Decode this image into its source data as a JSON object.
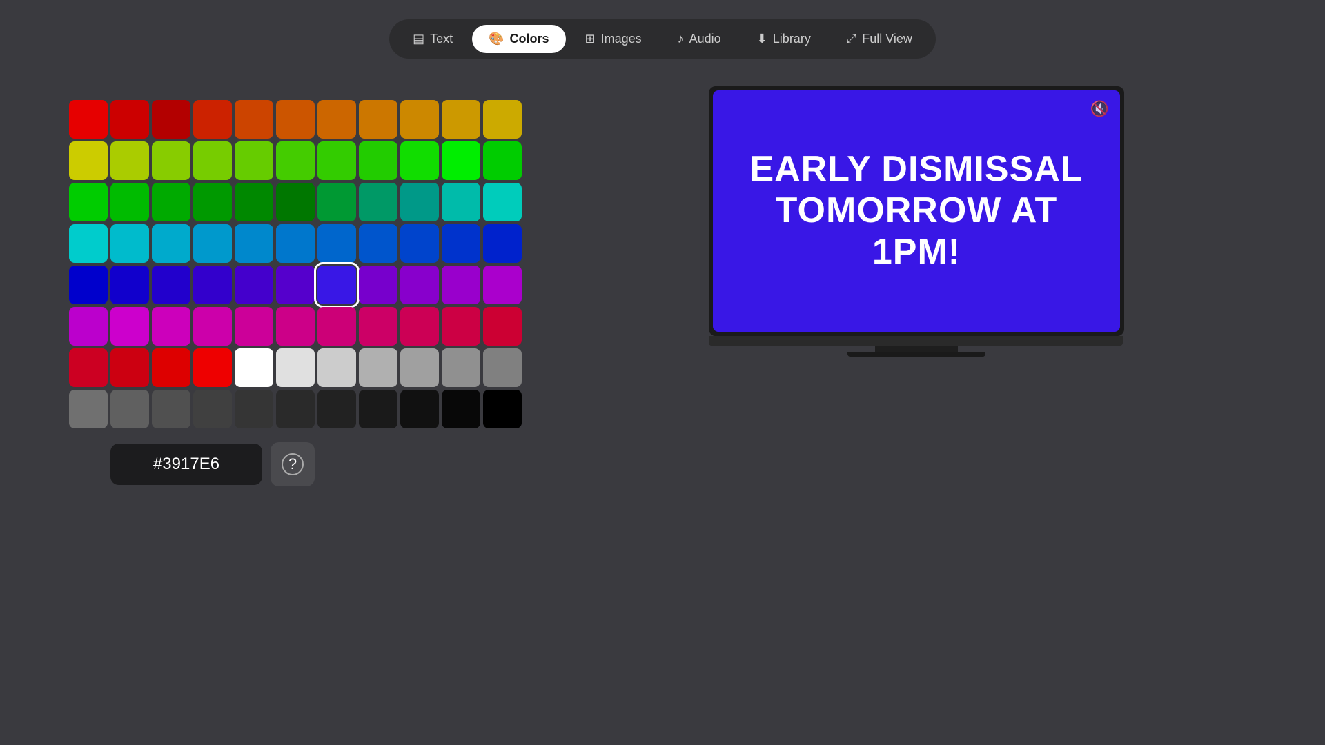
{
  "nav": {
    "items": [
      {
        "id": "text",
        "label": "Text",
        "icon": "📄",
        "active": false
      },
      {
        "id": "colors",
        "label": "Colors",
        "icon": "🎨",
        "active": true
      },
      {
        "id": "images",
        "label": "Images",
        "icon": "🖼",
        "active": false
      },
      {
        "id": "audio",
        "label": "Audio",
        "icon": "🎵",
        "active": false
      },
      {
        "id": "library",
        "label": "Library",
        "icon": "📥",
        "active": false
      },
      {
        "id": "fullview",
        "label": "Full View",
        "icon": "⤢",
        "active": false
      }
    ]
  },
  "colorGrid": {
    "rows": [
      [
        "#e60000",
        "#cc0000",
        "#b30000",
        "#cc2200",
        "#cc4400",
        "#cc5500",
        "#cc6600",
        "#cc7700",
        "#cc8800",
        "#cc9900",
        "#ccaa00"
      ],
      [
        "#cccc00",
        "#aacc00",
        "#88cc00",
        "#77cc00",
        "#66cc00",
        "#44cc00",
        "#33cc00",
        "#22cc00",
        "#11dd00",
        "#00ee00",
        "#00cc00"
      ],
      [
        "#00cc00",
        "#00bb00",
        "#00aa00",
        "#009900",
        "#008800",
        "#007700",
        "#009933",
        "#009966",
        "#009988",
        "#00bbaa",
        "#00ccbb"
      ],
      [
        "#00cccc",
        "#00bbcc",
        "#00aacc",
        "#0099cc",
        "#0088cc",
        "#0077cc",
        "#0066cc",
        "#0055cc",
        "#0044cc",
        "#0033cc",
        "#0022cc"
      ],
      [
        "#0000cc",
        "#1100cc",
        "#2200cc",
        "#3300cc",
        "#4400cc",
        "#5500cc",
        "#3917e6",
        "#7700cc",
        "#8800cc",
        "#9900cc",
        "#aa00cc"
      ],
      [
        "#bb00cc",
        "#cc00cc",
        "#cc00bb",
        "#cc00aa",
        "#cc0099",
        "#cc0088",
        "#cc0077",
        "#cc0066",
        "#cc0055",
        "#cc0044",
        "#cc0033"
      ],
      [
        "#cc0022",
        "#cc0011",
        "#dd0000",
        "#ee0000",
        "#ffffff",
        "#e0e0e0",
        "#cccccc",
        "#b0b0b0",
        "#a0a0a0",
        "#909090",
        "#808080"
      ],
      [
        "#707070",
        "#606060",
        "#505050",
        "#404040",
        "#353535",
        "#2a2a2a",
        "#222222",
        "#1a1a1a",
        "#111111",
        "#080808",
        "#000000"
      ]
    ],
    "selectedColor": "#3917e6",
    "selectedIndex": {
      "row": 4,
      "col": 6
    }
  },
  "hexInput": {
    "value": "#3917E6",
    "placeholder": "#3917E6"
  },
  "helpButton": {
    "label": "?"
  },
  "preview": {
    "bgColor": "#3917e6",
    "text": "EARLY DISMISSAL TOMORROW AT 1PM!",
    "muteIcon": "🔇"
  }
}
